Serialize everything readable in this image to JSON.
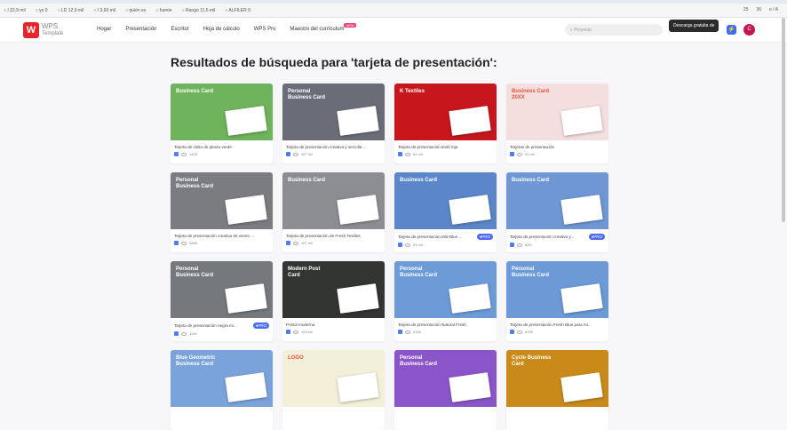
{
  "toolbar": {
    "items": [
      "I 22,9 mil",
      "yo 0",
      "LD 12,9 mil",
      "I 3,69 mil",
      "quién es",
      "fuente",
      "Rango 11,5 mil",
      "ALFILER 0"
    ],
    "right": [
      "25",
      "36",
      "e / A"
    ]
  },
  "header": {
    "logo_title": "WPS",
    "logo_sub": "Template",
    "nav": [
      "Hogar",
      "Presentación",
      "Escritor",
      "Hoja de cálculo",
      "WPS Pro",
      "Maestro del currículum"
    ],
    "new_badge": "NEW",
    "search_placeholder": "Proyecto",
    "tooltip": "Descarga gratuita de",
    "avatar": "C"
  },
  "page_title": "Resultados de búsqueda para 'tarjeta de presentación':",
  "cards": [
    {
      "title": "Tarjeta de visita de planta verde",
      "views": "142K",
      "thumb": "Business Card",
      "bg": "#6fb35c",
      "pro": false
    },
    {
      "title": "Tarjeta de presentación creativa y sencilla ...",
      "views": "287 mil",
      "thumb": "Personal Business Card",
      "bg": "#6a6d78",
      "pro": false
    },
    {
      "title": "Tarjeta de presentación textil roja",
      "views": "81 mil",
      "thumb": "K Textiles",
      "bg": "#c8161d",
      "pro": false
    },
    {
      "title": "Tarjetas de presentación",
      "views": "25 mil",
      "thumb": "Business Card 20XX",
      "bg": "#f4dede",
      "pro": false
    },
    {
      "title": "Tarjeta de presentación creativa de viento ...",
      "views": "286K",
      "thumb": "Personal Business Card",
      "bg": "#7a7c80",
      "pro": false
    },
    {
      "title": "Tarjeta de presentación de Fresh Textiles",
      "views": "107 mil",
      "thumb": "Business Card",
      "bg": "#8b8d91",
      "pro": false
    },
    {
      "title": "Tarjeta de presentación Mid-Blue ...",
      "views": "29 mil",
      "thumb": "Business Card",
      "bg": "#5b86c9",
      "pro": true
    },
    {
      "title": "Tarjeta de presentación creativa y...",
      "views": "62K",
      "thumb": "Business Card",
      "bg": "#6f97d4",
      "pro": true
    },
    {
      "title": "Tarjeta de presentación negra mi...",
      "views": "110K",
      "thumb": "Personal Business Card",
      "bg": "#75787c",
      "pro": true
    },
    {
      "title": "Postal moderna",
      "views": "100 mil",
      "thumb": "Modern Post Card",
      "bg": "#333533",
      "pro": false
    },
    {
      "title": "Tarjeta de presentación Natural Fresh",
      "views": "234K",
      "thumb": "Personal Business Card",
      "bg": "#6d9bd8",
      "pro": false
    },
    {
      "title": "Tarjeta de presentación Fresh Blue para mi...",
      "views": "475K",
      "thumb": "Personal Business Card",
      "bg": "#6b9ad6",
      "pro": false
    },
    {
      "title": "",
      "views": "",
      "thumb": "Blue Geometric Business Card",
      "bg": "#7aa3dc",
      "pro": false
    },
    {
      "title": "",
      "views": "",
      "thumb": "LOGO",
      "bg": "#f3efd9",
      "pro": false
    },
    {
      "title": "",
      "views": "",
      "thumb": "Personal Business Card",
      "bg": "#8a55c9",
      "pro": false
    },
    {
      "title": "",
      "views": "",
      "thumb": "Cycle Business Card",
      "bg": "#c98a1a",
      "pro": false
    }
  ],
  "pro_label": "PRO"
}
